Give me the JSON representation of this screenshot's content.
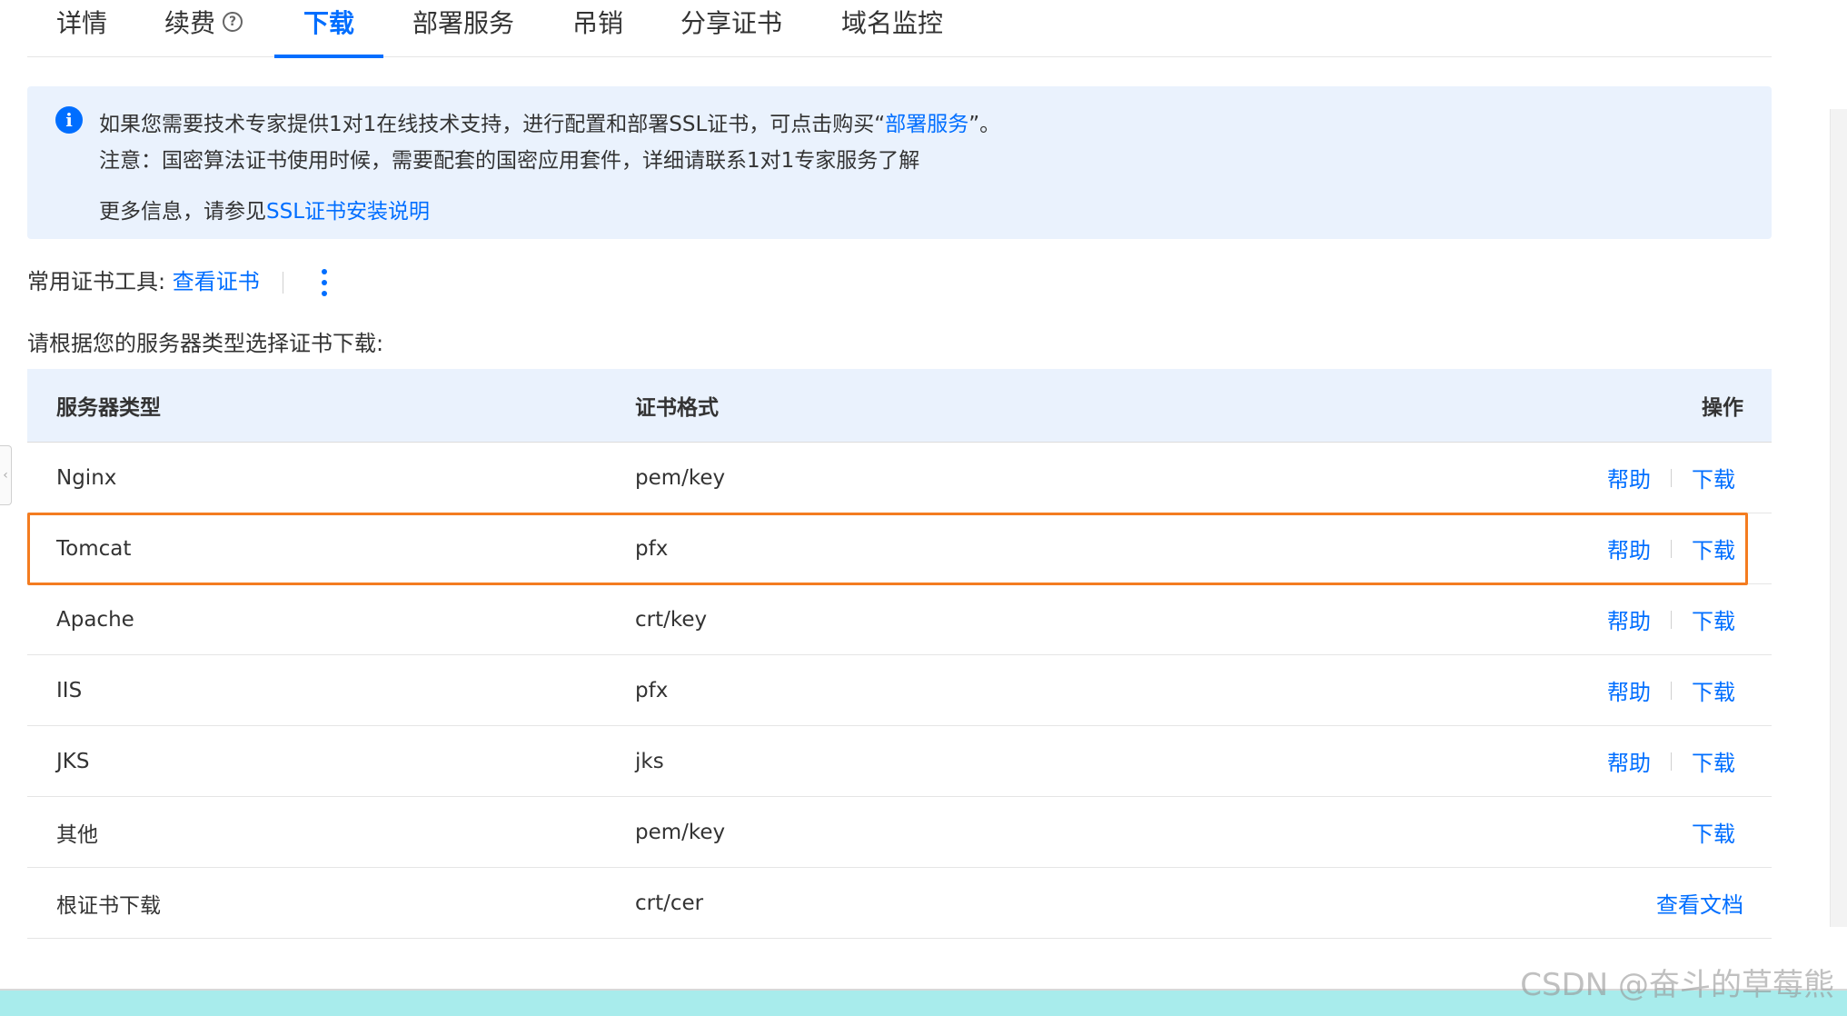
{
  "tabs": [
    {
      "label": "详情",
      "active": false
    },
    {
      "label": "续费",
      "active": false,
      "help_icon": "?"
    },
    {
      "label": "下载",
      "active": true
    },
    {
      "label": "部署服务",
      "active": false
    },
    {
      "label": "吊销",
      "active": false
    },
    {
      "label": "分享证书",
      "active": false
    },
    {
      "label": "域名监控",
      "active": false
    }
  ],
  "info": {
    "icon": "info-icon",
    "line1_prefix": "如果您需要技术专家提供1对1在线技术支持，进行配置和部署SSL证书，可点击购买“",
    "line1_link": "部署服务",
    "line1_suffix": "”。",
    "line2": "注意：国密算法证书使用时候，需要配套的国密应用套件，详细请联系1对1专家服务了解",
    "line3_prefix": "更多信息，请参见",
    "line3_link": "SSL证书安装说明"
  },
  "tools": {
    "label": "常用证书工具:",
    "link": "查看证书",
    "more_icon": "more-vertical-icon"
  },
  "select_hint": "请根据您的服务器类型选择证书下载:",
  "table": {
    "headers": {
      "type": "服务器类型",
      "format": "证书格式",
      "action": "操作"
    },
    "rows": [
      {
        "type": "Nginx",
        "format": "pem/key",
        "help": "帮助",
        "download": "下载"
      },
      {
        "type": "Tomcat",
        "format": "pfx",
        "help": "帮助",
        "download": "下载",
        "highlighted": true
      },
      {
        "type": "Apache",
        "format": "crt/key",
        "help": "帮助",
        "download": "下载"
      },
      {
        "type": "IIS",
        "format": "pfx",
        "help": "帮助",
        "download": "下载"
      },
      {
        "type": "JKS",
        "format": "jks",
        "help": "帮助",
        "download": "下载"
      },
      {
        "type": "其他",
        "format": "pem/key",
        "download": "下载"
      },
      {
        "type": "根证书下载",
        "format": "crt/cer",
        "doc": "查看文档"
      }
    ]
  },
  "watermark": "CSDN @奋斗的草莓熊",
  "colors": {
    "accent": "#006eff",
    "highlight_border": "#f47c20",
    "info_bg": "#eaf2fd"
  }
}
